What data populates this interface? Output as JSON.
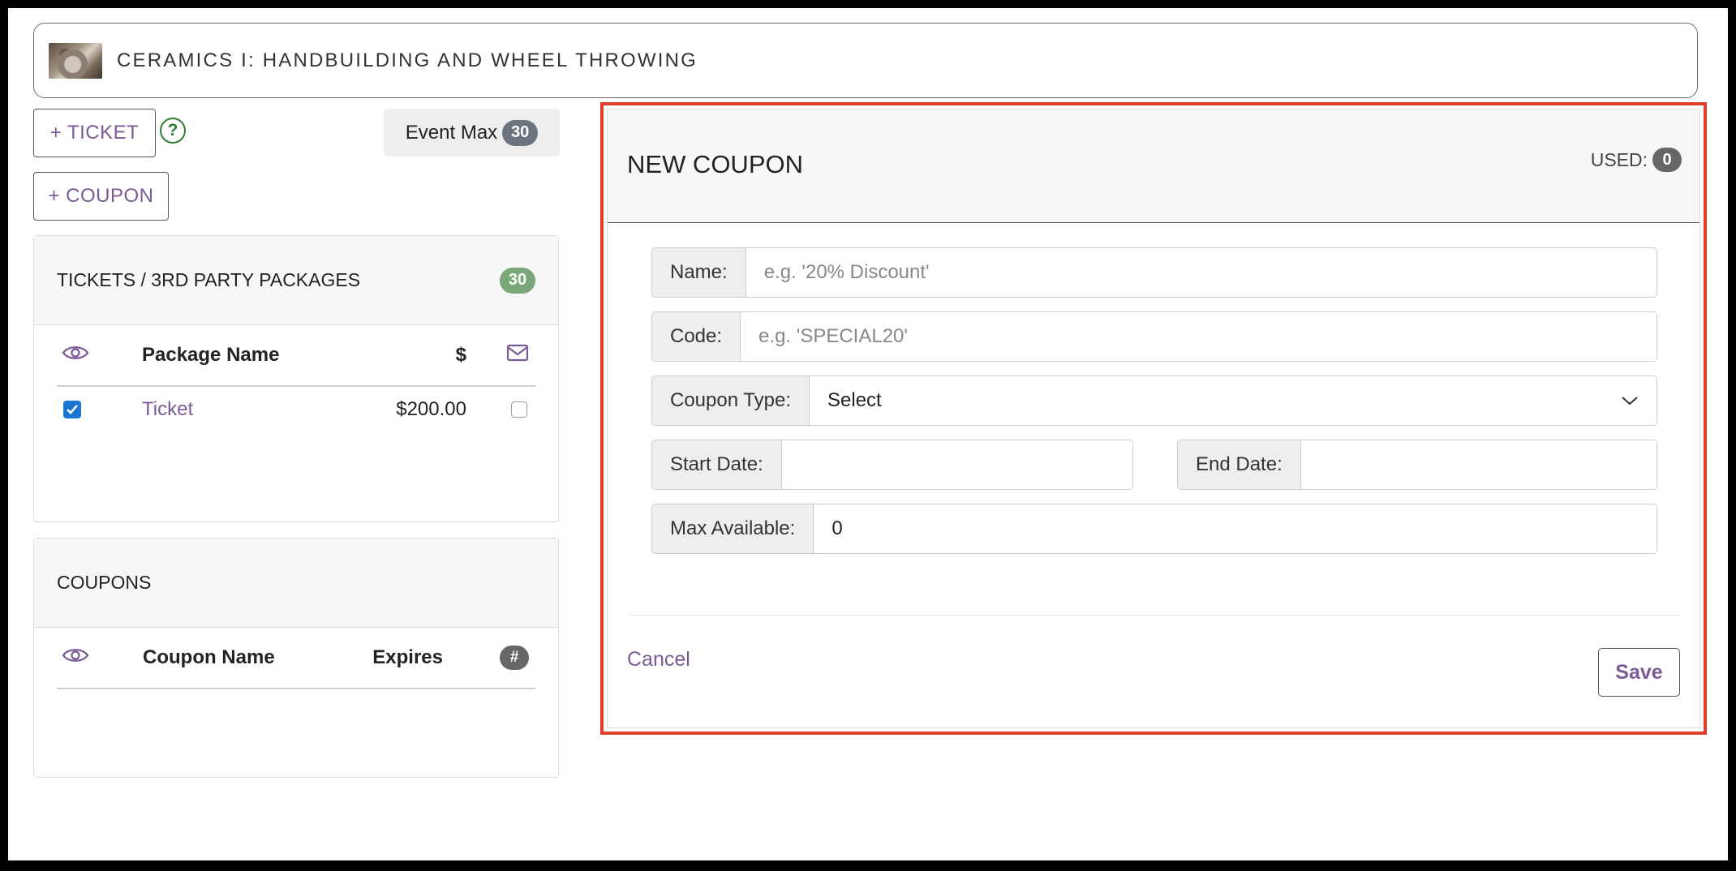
{
  "header": {
    "title": "CERAMICS I: HANDBUILDING AND WHEEL THROWING",
    "thumbnail_icon": "ceramics-photo"
  },
  "actions": {
    "add_ticket_label": "+ TICKET",
    "add_coupon_label": "+ COUPON",
    "help_glyph": "?"
  },
  "event_max": {
    "label": "Event Max",
    "value": "30"
  },
  "tickets_card": {
    "title": "TICKETS / 3RD PARTY PACKAGES",
    "count": "30",
    "columns": {
      "visible_icon": "eye-icon",
      "name": "Package Name",
      "price": "$",
      "email_icon": "mail-icon"
    },
    "rows": [
      {
        "visible": true,
        "name": "Ticket",
        "price": "$200.00",
        "email": false
      }
    ]
  },
  "coupons_card": {
    "title": "COUPONS",
    "columns": {
      "visible_icon": "eye-icon",
      "name": "Coupon Name",
      "expires": "Expires",
      "count": "#"
    },
    "rows": []
  },
  "new_coupon": {
    "title": "NEW COUPON",
    "used_label": "USED:",
    "used_count": "0",
    "name": {
      "label": "Name:",
      "value": "",
      "placeholder": "e.g. '20% Discount'"
    },
    "code": {
      "label": "Code:",
      "value": "",
      "placeholder": "e.g. 'SPECIAL20'"
    },
    "coupon_type": {
      "label": "Coupon Type:",
      "selected": "Select"
    },
    "start_date": {
      "label": "Start Date:",
      "value": ""
    },
    "end_date": {
      "label": "End Date:",
      "value": ""
    },
    "max_available": {
      "label": "Max Available:",
      "value": "0"
    },
    "cancel_label": "Cancel",
    "save_label": "Save"
  },
  "colors": {
    "accent": "#7b5b95",
    "highlight_border": "#e03e2d",
    "count_green": "#7aa87a",
    "help_green": "#2e7d32"
  }
}
